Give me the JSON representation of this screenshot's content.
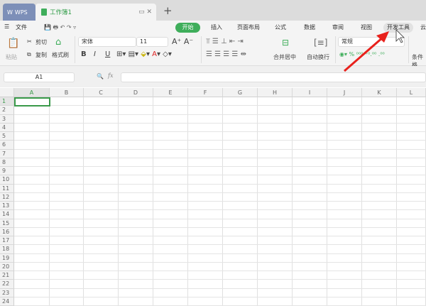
{
  "tabs": {
    "wps": "WPS",
    "doc": "工作簿1",
    "new": "+"
  },
  "menu": {
    "file": "文件",
    "items": [
      "开始",
      "插入",
      "页面布局",
      "公式",
      "数据",
      "审阅",
      "视图",
      "开发工具",
      "云"
    ]
  },
  "ribbon": {
    "paste": "粘贴",
    "cut": "剪切",
    "copy": "复制",
    "format_painter": "格式刷",
    "font": "宋体",
    "size": "11",
    "merge": "合并居中",
    "wrap": "自动换行",
    "number_format": "常规",
    "cond_format": "条件格",
    "bold": "B",
    "italic": "I",
    "underline": "U"
  },
  "formula_bar": {
    "cell_ref": "A1",
    "fx": "fx",
    "value": ""
  },
  "columns": [
    "A",
    "B",
    "C",
    "D",
    "E",
    "F",
    "G",
    "H",
    "I",
    "J",
    "K",
    "L"
  ],
  "rows": [
    "1",
    "2",
    "3",
    "4",
    "5",
    "6",
    "7",
    "8",
    "9",
    "10",
    "11",
    "12",
    "13",
    "14",
    "15",
    "16",
    "17",
    "18",
    "19",
    "20",
    "21",
    "22",
    "23",
    "24"
  ],
  "colors": {
    "accent": "#3fae5b",
    "arrow": "#e8211c"
  }
}
